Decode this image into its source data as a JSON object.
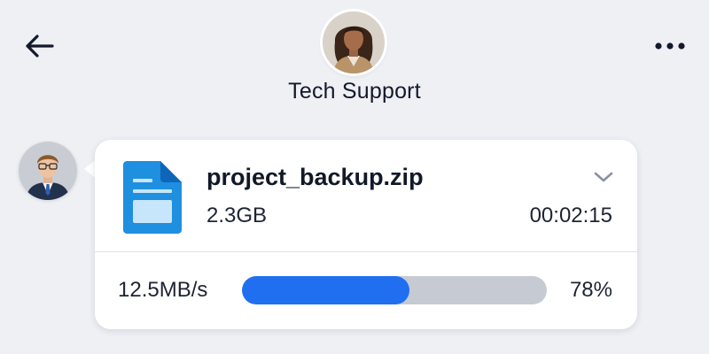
{
  "header": {
    "contact_name": "Tech Support",
    "icons": {
      "back": "back-arrow-icon",
      "more": "more-options-icon"
    }
  },
  "message": {
    "file": {
      "name": "project_backup.zip",
      "size": "2.3GB",
      "duration": "00:02:15",
      "icon": "file-document-icon"
    },
    "transfer": {
      "speed": "12.5MB/s",
      "percent_label": "78%",
      "progress_fraction": 0.55
    },
    "expand_icon": "chevron-down-icon"
  },
  "colors": {
    "background": "#eef0f4",
    "accent": "#1f6ff0",
    "track": "#c6cad2",
    "bubble": "#ffffff",
    "text": "#121a2c"
  }
}
